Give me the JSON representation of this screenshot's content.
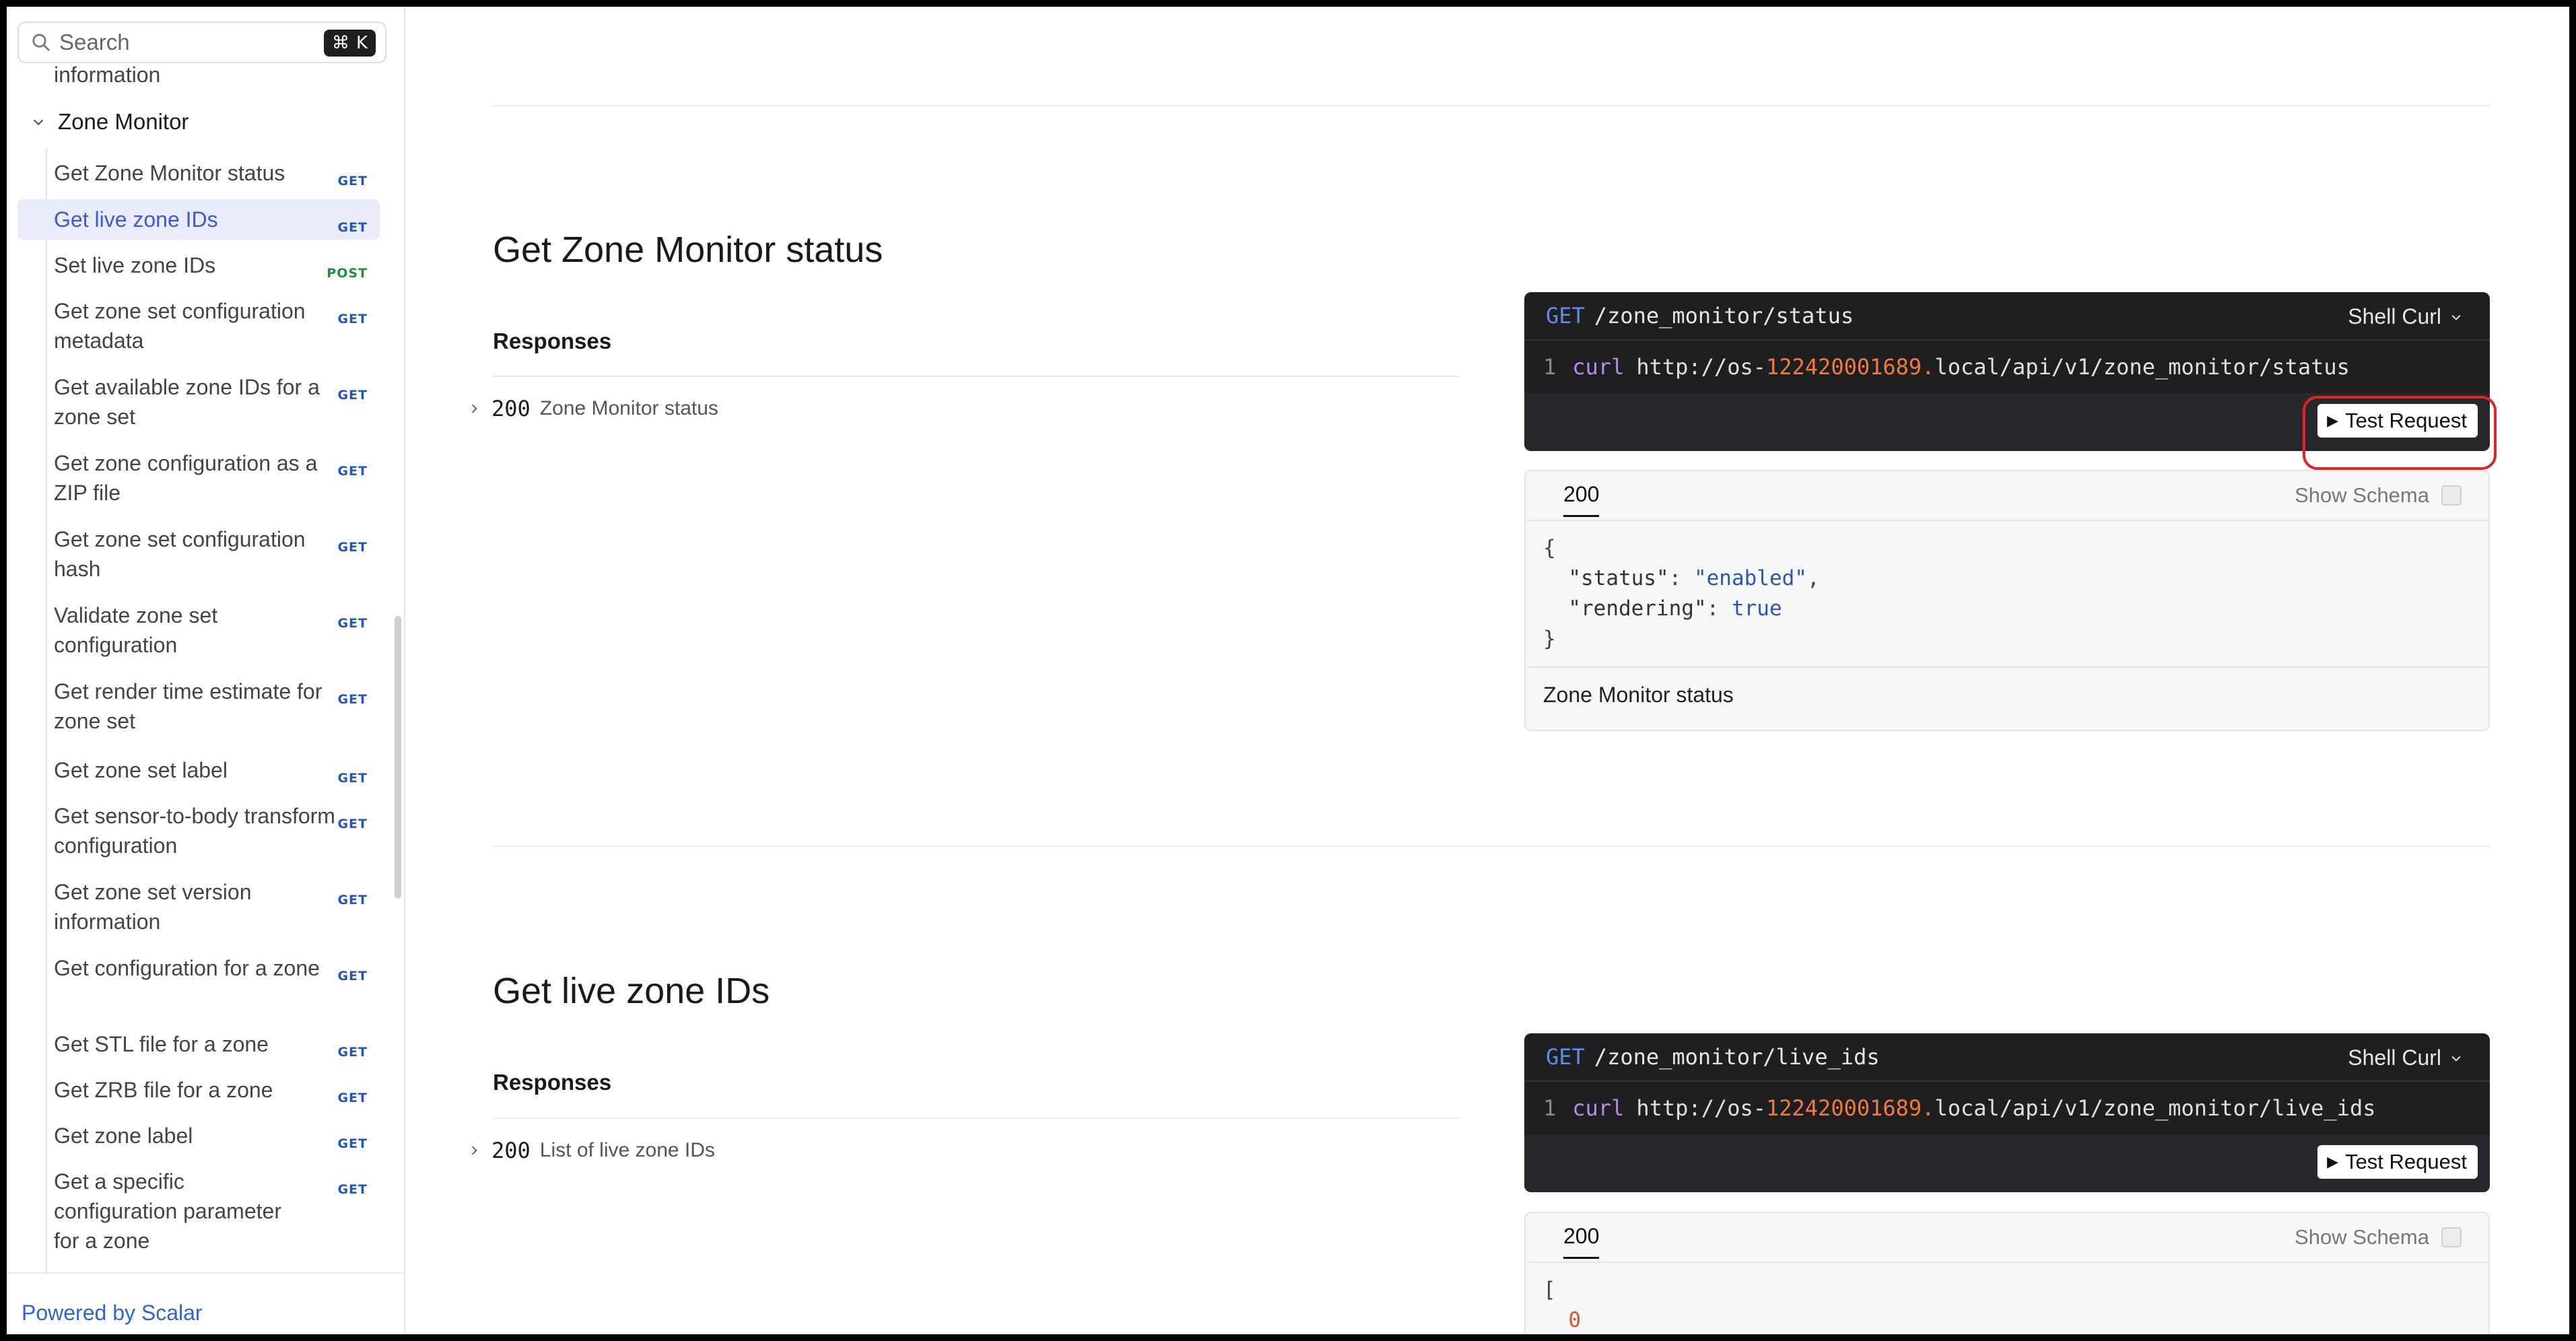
{
  "sidebar": {
    "search_placeholder": "Search",
    "shortcut_symbol": "⌘",
    "shortcut_key": "K",
    "cut_off_item": "information",
    "group_title": "Zone Monitor",
    "items": [
      {
        "label": "Get Zone Monitor status",
        "method": "GET"
      },
      {
        "label": "Get live zone IDs",
        "method": "GET"
      },
      {
        "label": "Set live zone IDs",
        "method": "POST"
      },
      {
        "label": "Get zone set configuration metadata",
        "method": "GET"
      },
      {
        "label": "Get available zone IDs for a zone set",
        "method": "GET"
      },
      {
        "label": "Get zone configuration as a ZIP file",
        "method": "GET"
      },
      {
        "label": "Get zone set configuration hash",
        "method": "GET"
      },
      {
        "label": "Validate zone set configuration",
        "method": "GET"
      },
      {
        "label": "Get render time estimate for zone set",
        "method": "GET"
      },
      {
        "label": "Get zone set label",
        "method": "GET"
      },
      {
        "label": "Get sensor-to-body transform configuration",
        "method": "GET"
      },
      {
        "label": "Get zone set version information",
        "method": "GET"
      },
      {
        "label": "Get configuration for a zone",
        "method": "GET"
      },
      {
        "label": "Get STL file for a zone",
        "method": "GET"
      },
      {
        "label": "Get ZRB file for a zone",
        "method": "GET"
      },
      {
        "label": "Get zone label",
        "method": "GET"
      },
      {
        "label": "Get a specific configuration parameter for a zone",
        "method": "GET"
      }
    ],
    "footer": "Powered by Scalar"
  },
  "sections": [
    {
      "title": "Get Zone Monitor status",
      "responses_label": "Responses",
      "response_code": "200",
      "response_desc": "Zone Monitor status",
      "verb": "GET",
      "path": "/zone_monitor/status",
      "language": "Shell Curl",
      "line_no": "1",
      "cmd": "curl",
      "url_prefix": "http://os-",
      "url_highlight": "122420001689.",
      "url_suffix": "local/api/v1/zone_monitor/status",
      "test_button": "Test Request",
      "tab": "200",
      "show_schema": "Show Schema",
      "json_open": "{",
      "json_close": "}",
      "json_key1": "\"status\"",
      "json_val1": "\"enabled\"",
      "json_key2": "\"rendering\"",
      "json_val2": "true",
      "footer": "Zone Monitor status"
    },
    {
      "title": "Get live zone IDs",
      "responses_label": "Responses",
      "response_code": "200",
      "response_desc": "List of live zone IDs",
      "verb": "GET",
      "path": "/zone_monitor/live_ids",
      "language": "Shell Curl",
      "line_no": "1",
      "cmd": "curl",
      "url_prefix": "http://os-",
      "url_highlight": "122420001689.",
      "url_suffix": "local/api/v1/zone_monitor/live_ids",
      "test_button": "Test Request",
      "tab": "200",
      "show_schema": "Show Schema",
      "json_open": "[",
      "json_first": "0"
    }
  ]
}
